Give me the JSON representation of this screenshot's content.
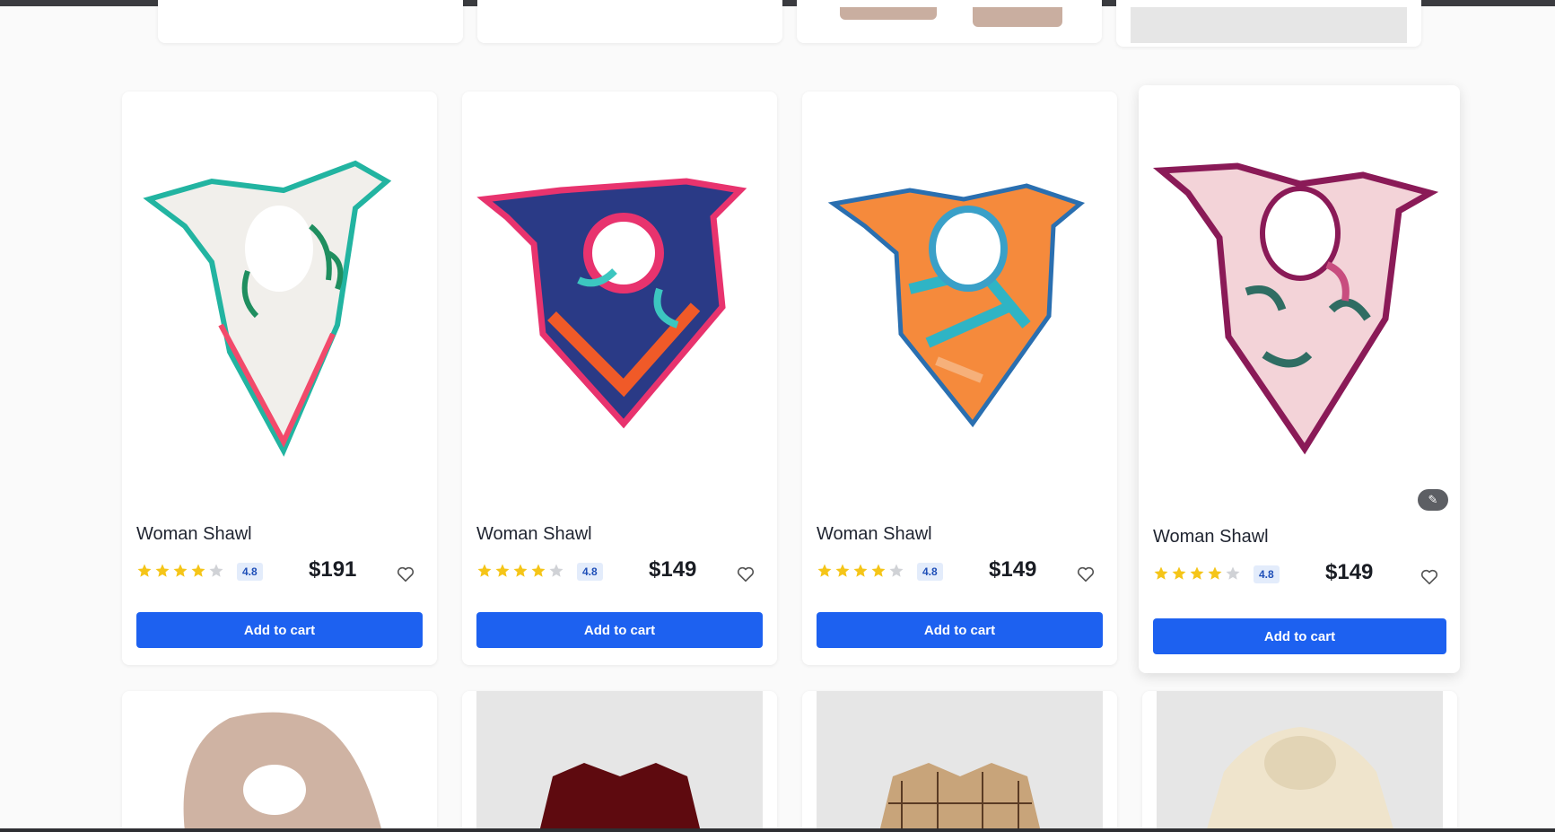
{
  "products": [
    {
      "title": "Woman Shawl",
      "rating": "4.8",
      "price": "$191",
      "stars": 4,
      "cart_label": "Add to cart"
    },
    {
      "title": "Woman Shawl",
      "rating": "4.8",
      "price": "$149",
      "stars": 4,
      "cart_label": "Add to cart"
    },
    {
      "title": "Woman Shawl",
      "rating": "4.8",
      "price": "$149",
      "stars": 4,
      "cart_label": "Add to cart"
    },
    {
      "title": "Woman Shawl",
      "rating": "4.8",
      "price": "$149",
      "stars": 4,
      "cart_label": "Add to cart"
    }
  ],
  "icons": {
    "star": "star-icon",
    "heart": "heart-icon",
    "magic": "magic-wand-icon"
  },
  "colors": {
    "accent": "#1d61f0",
    "star_filled": "#f5c518",
    "star_empty": "#d0d2d6",
    "rating_bg": "#e3ecfb"
  }
}
